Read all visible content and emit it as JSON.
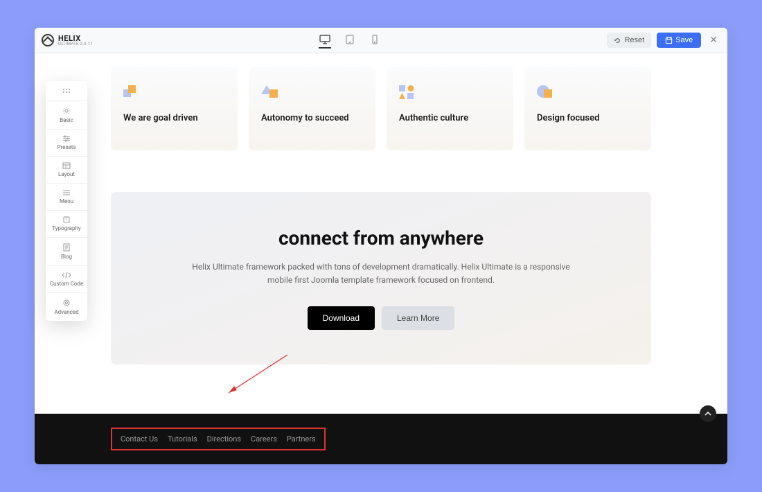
{
  "logo": {
    "title": "HELIX",
    "subtitle": "ULTIMATE 2.0.11"
  },
  "toolbar": {
    "reset_label": "Reset",
    "save_label": "Save"
  },
  "sidebar": {
    "items": [
      {
        "label": ""
      },
      {
        "label": "Basic"
      },
      {
        "label": "Presets"
      },
      {
        "label": "Layout"
      },
      {
        "label": "Menu"
      },
      {
        "label": "Typography"
      },
      {
        "label": "Blog"
      },
      {
        "label": "Custom Code"
      },
      {
        "label": "Advanced"
      }
    ]
  },
  "cards": [
    {
      "title": "We are goal driven"
    },
    {
      "title": "Autonomy to succeed"
    },
    {
      "title": "Authentic culture"
    },
    {
      "title": "Design focused"
    }
  ],
  "cta": {
    "title": "connect from anywhere",
    "description": "Helix Ultimate framework packed with tons of development dramatically. Helix Ultimate is a responsive mobile first Joomla template framework focused on frontend.",
    "download_label": "Download",
    "learn_label": "Learn More"
  },
  "footer": {
    "links": [
      "Contact Us",
      "Tutorials",
      "Directions",
      "Careers",
      "Partners"
    ]
  }
}
